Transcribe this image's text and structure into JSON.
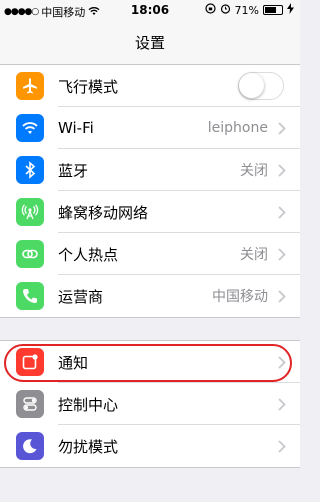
{
  "status_bar": {
    "signal": "●●●●○",
    "carrier": "中国移动",
    "time": "18:06",
    "battery_percent": "71%",
    "battery_level": 0.71
  },
  "nav": {
    "title": "设置"
  },
  "colors": {
    "airplane": "#ff9500",
    "wifi": "#007aff",
    "bluetooth": "#007aff",
    "cellular": "#4cd964",
    "hotspot": "#4cd964",
    "carrier": "#4cd964",
    "notifications": "#ff3b30",
    "control_center": "#8e8e93",
    "dnd": "#5856d6",
    "highlight": "#e02525"
  },
  "group1": {
    "items": [
      {
        "label": "飞行模式",
        "icon": "airplane-icon",
        "toggle_on": false
      },
      {
        "label": "Wi-Fi",
        "icon": "wifi-icon",
        "value": "leiphone"
      },
      {
        "label": "蓝牙",
        "icon": "bluetooth-icon",
        "value": "关闭"
      },
      {
        "label": "蜂窝移动网络",
        "icon": "cellular-icon"
      },
      {
        "label": "个人热点",
        "icon": "hotspot-icon",
        "value": "关闭"
      },
      {
        "label": "运营商",
        "icon": "phone-icon",
        "value": "中国移动"
      }
    ]
  },
  "group2": {
    "items": [
      {
        "label": "通知",
        "icon": "notifications-icon"
      },
      {
        "label": "控制中心",
        "icon": "control-center-icon"
      },
      {
        "label": "勿扰模式",
        "icon": "moon-icon"
      }
    ]
  }
}
